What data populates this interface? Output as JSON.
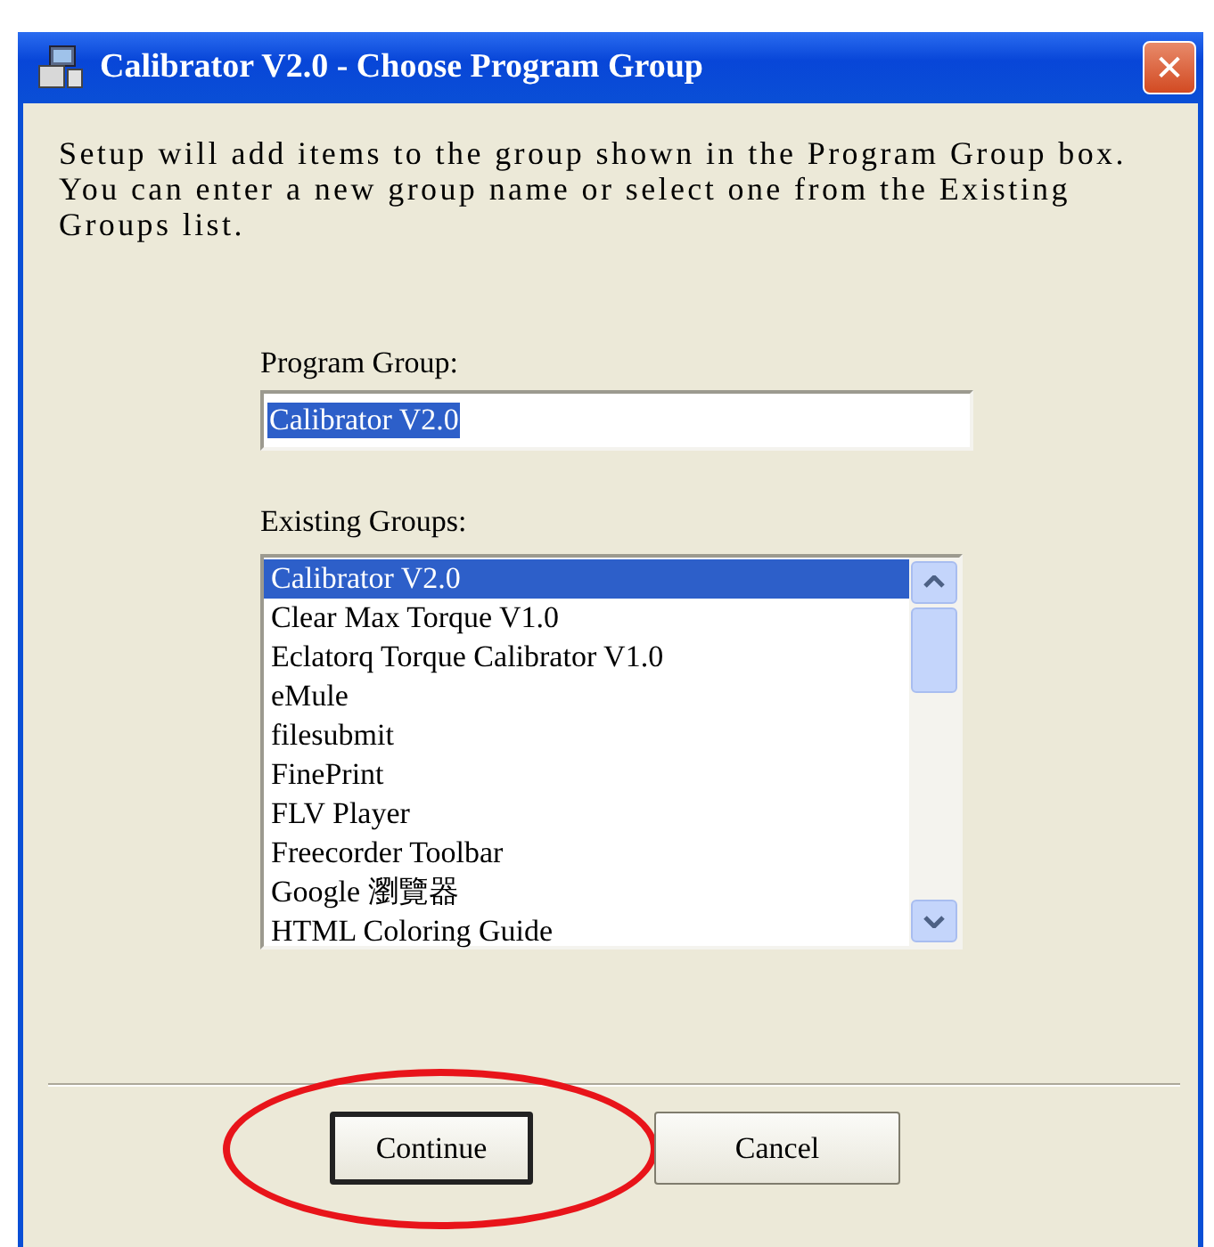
{
  "window": {
    "title": "Calibrator V2.0 - Choose Program Group",
    "close": "✕"
  },
  "description": "Setup will add items to the group shown in the Program Group box. You can enter a new group name or select one from the Existing Groups list.",
  "program_group": {
    "label": "Program Group:",
    "value": "Calibrator V2.0",
    "value_selected": true
  },
  "existing_groups": {
    "label": "Existing Groups:",
    "items": [
      {
        "label": "Calibrator V2.0",
        "selected": true
      },
      {
        "label": "Clear Max Torque V1.0",
        "selected": false
      },
      {
        "label": "Eclatorq Torque Calibrator V1.0",
        "selected": false
      },
      {
        "label": "eMule",
        "selected": false
      },
      {
        "label": "filesubmit",
        "selected": false
      },
      {
        "label": "FinePrint",
        "selected": false
      },
      {
        "label": "FLV Player",
        "selected": false
      },
      {
        "label": "Freecorder Toolbar",
        "selected": false
      },
      {
        "label": "Google 瀏覽器",
        "selected": false
      },
      {
        "label": "HTML Coloring Guide",
        "selected": false
      }
    ]
  },
  "buttons": [
    {
      "label": "Continue",
      "default": true,
      "circled": true
    },
    {
      "label": "Cancel",
      "default": false,
      "circled": false
    }
  ]
}
